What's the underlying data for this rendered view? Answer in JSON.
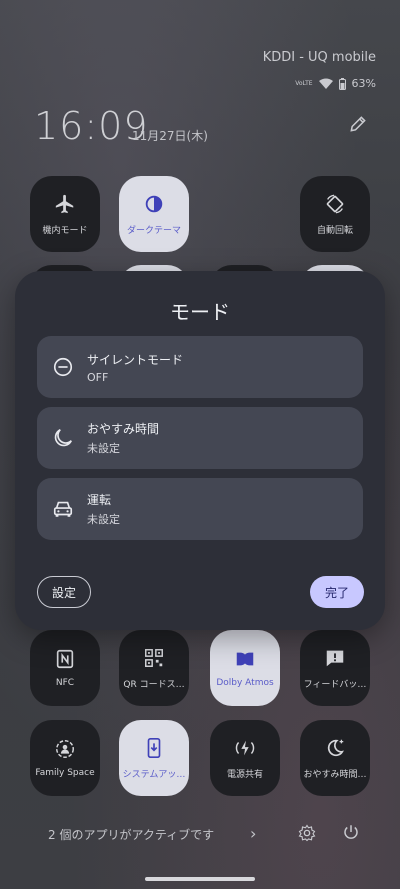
{
  "status_bar": {
    "carrier": "KDDI - UQ mobile",
    "volte": "VoLTE",
    "battery": "63%"
  },
  "header": {
    "time": "16:09",
    "date": "11月27日(木)"
  },
  "tiles_top": [
    {
      "label": "機内モード",
      "icon": "airplane-icon",
      "active": false
    },
    {
      "label": "ダークテーマ",
      "icon": "dark-theme-icon",
      "active": true
    },
    {
      "label": "自動回転",
      "icon": "auto-rotate-icon",
      "active": false
    }
  ],
  "tiles_row3": [
    {
      "label": "NFC",
      "icon": "nfc-icon",
      "active": false
    },
    {
      "label": "QR コードス…",
      "icon": "qr-code-icon",
      "active": false
    },
    {
      "label": "Dolby Atmos",
      "icon": "dolby-icon",
      "active": true
    },
    {
      "label": "フィードバッ…",
      "icon": "feedback-icon",
      "active": false
    }
  ],
  "tiles_row4": [
    {
      "label": "Family Space",
      "icon": "family-space-icon",
      "active": false
    },
    {
      "label": "システムアッ…",
      "icon": "system-update-icon",
      "active": true
    },
    {
      "label": "電源共有",
      "icon": "power-share-icon",
      "active": false
    },
    {
      "label": "おやすみ時間…",
      "icon": "bedtime-icon",
      "active": false
    }
  ],
  "footer": {
    "active_apps": "2 個のアプリがアクティブです",
    "chevron": "›"
  },
  "dialog": {
    "title": "モード",
    "options": [
      {
        "title": "サイレントモード",
        "value": "OFF",
        "icon": "do-not-disturb-icon"
      },
      {
        "title": "おやすみ時間",
        "value": "未設定",
        "icon": "moon-icon"
      },
      {
        "title": "運転",
        "value": "未設定",
        "icon": "car-icon"
      }
    ],
    "settings_label": "設定",
    "done_label": "完了"
  },
  "colors": {
    "accent": "#c8c8ff",
    "active_tile": "#dcdde6",
    "active_icon": "#3f41b8"
  }
}
